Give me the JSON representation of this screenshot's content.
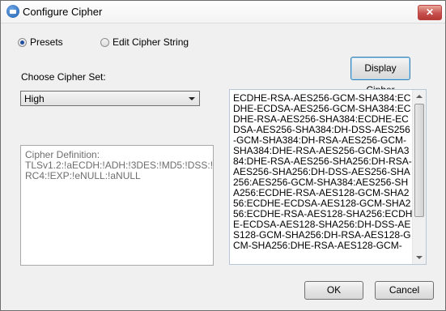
{
  "window": {
    "title": "Configure Cipher",
    "close_label": "✕"
  },
  "mode": {
    "presets_label": "Presets",
    "edit_label": "Edit Cipher String",
    "selected": "presets"
  },
  "cipher_set": {
    "label": "Choose Cipher Set:",
    "selected": "High"
  },
  "display_button_label": "Display Cipher",
  "definition": "Cipher Definition:\nTLSv1.2:!aECDH:!ADH:!3DES:!MD5:!DSS:!\nRC4:!EXP:!eNULL:!aNULL",
  "cipher_list": "ECDHE-RSA-AES256-GCM-SHA384:ECDHE-ECDSA-AES256-GCM-SHA384:ECDHE-RSA-AES256-SHA384:ECDHE-ECDSA-AES256-SHA384:DH-DSS-AES256-GCM-SHA384:DH-RSA-AES256-GCM-SHA384:DHE-RSA-AES256-GCM-SHA384:DHE-RSA-AES256-SHA256:DH-RSA-AES256-SHA256:DH-DSS-AES256-SHA256:AES256-GCM-SHA384:AES256-SHA256:ECDHE-RSA-AES128-GCM-SHA256:ECDHE-ECDSA-AES128-GCM-SHA256:ECDHE-RSA-AES128-SHA256:ECDHE-ECDSA-AES128-SHA256:DH-DSS-AES128-GCM-SHA256:DH-RSA-AES128-GCM-SHA256:DHE-RSA-AES128-GCM-",
  "ok_label": "OK",
  "cancel_label": "Cancel"
}
